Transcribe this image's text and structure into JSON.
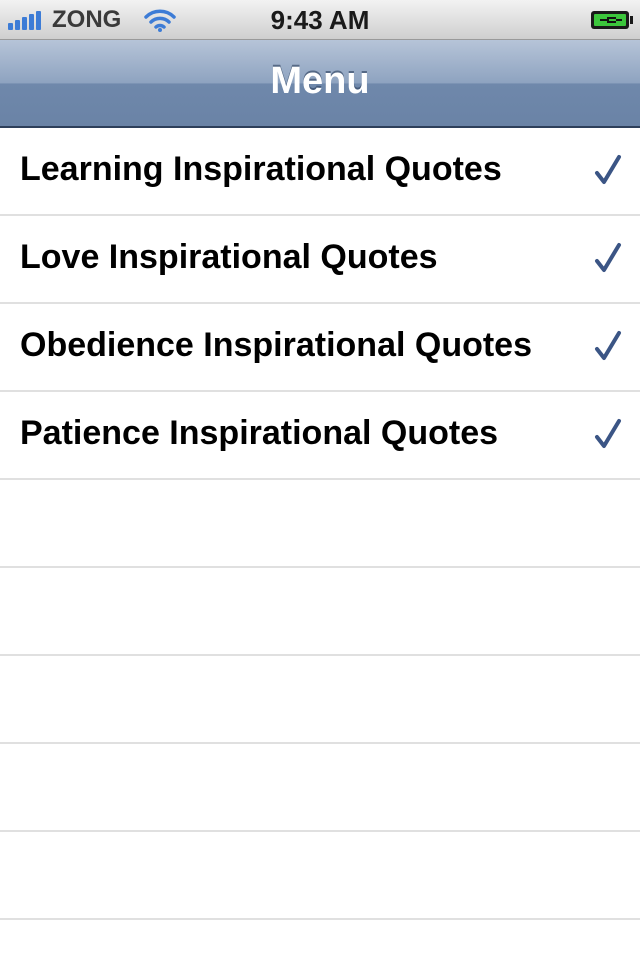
{
  "status_bar": {
    "carrier": "ZONG",
    "time": "9:43 AM",
    "signal_icon": "signal-bars-icon",
    "wifi_icon": "wifi-icon",
    "battery_icon": "battery-charging-icon",
    "signal_color": "#3d7cd6",
    "battery_color": "#3cc63c"
  },
  "nav_bar": {
    "title": "Menu"
  },
  "menu": {
    "items": [
      {
        "label": "Learning Inspirational Quotes",
        "checked": true
      },
      {
        "label": "Love Inspirational Quotes",
        "checked": true
      },
      {
        "label": "Obedience Inspirational Quotes",
        "checked": true
      },
      {
        "label": "Patience Inspirational Quotes",
        "checked": true
      }
    ],
    "checkmark_icon": "checkmark-icon",
    "checkmark_color": "#3b5585"
  }
}
